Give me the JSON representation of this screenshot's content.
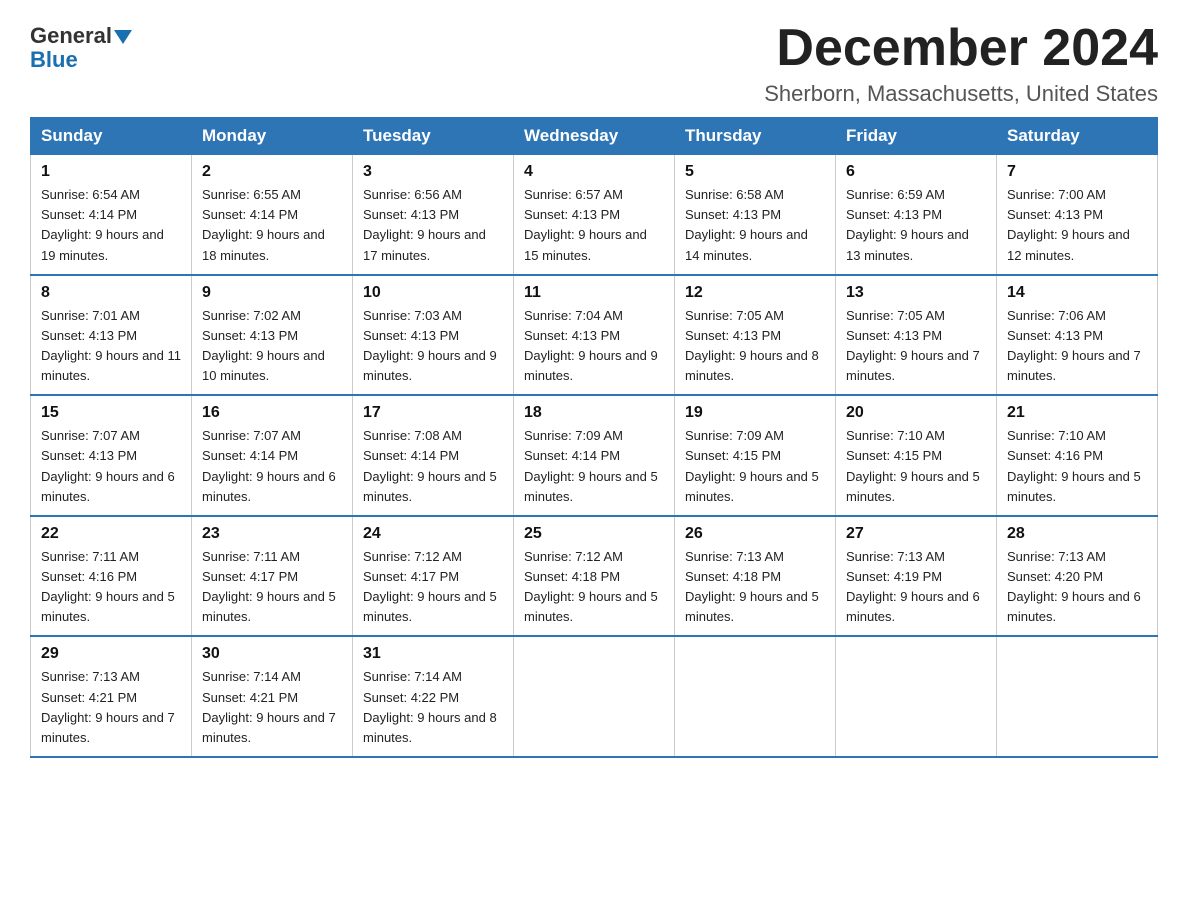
{
  "header": {
    "logo_line1": "General",
    "logo_line2": "Blue",
    "month_title": "December 2024",
    "location": "Sherborn, Massachusetts, United States"
  },
  "days_of_week": [
    "Sunday",
    "Monday",
    "Tuesday",
    "Wednesday",
    "Thursday",
    "Friday",
    "Saturday"
  ],
  "weeks": [
    [
      {
        "day": "1",
        "sunrise": "6:54 AM",
        "sunset": "4:14 PM",
        "daylight": "9 hours and 19 minutes."
      },
      {
        "day": "2",
        "sunrise": "6:55 AM",
        "sunset": "4:14 PM",
        "daylight": "9 hours and 18 minutes."
      },
      {
        "day": "3",
        "sunrise": "6:56 AM",
        "sunset": "4:13 PM",
        "daylight": "9 hours and 17 minutes."
      },
      {
        "day": "4",
        "sunrise": "6:57 AM",
        "sunset": "4:13 PM",
        "daylight": "9 hours and 15 minutes."
      },
      {
        "day": "5",
        "sunrise": "6:58 AM",
        "sunset": "4:13 PM",
        "daylight": "9 hours and 14 minutes."
      },
      {
        "day": "6",
        "sunrise": "6:59 AM",
        "sunset": "4:13 PM",
        "daylight": "9 hours and 13 minutes."
      },
      {
        "day": "7",
        "sunrise": "7:00 AM",
        "sunset": "4:13 PM",
        "daylight": "9 hours and 12 minutes."
      }
    ],
    [
      {
        "day": "8",
        "sunrise": "7:01 AM",
        "sunset": "4:13 PM",
        "daylight": "9 hours and 11 minutes."
      },
      {
        "day": "9",
        "sunrise": "7:02 AM",
        "sunset": "4:13 PM",
        "daylight": "9 hours and 10 minutes."
      },
      {
        "day": "10",
        "sunrise": "7:03 AM",
        "sunset": "4:13 PM",
        "daylight": "9 hours and 9 minutes."
      },
      {
        "day": "11",
        "sunrise": "7:04 AM",
        "sunset": "4:13 PM",
        "daylight": "9 hours and 9 minutes."
      },
      {
        "day": "12",
        "sunrise": "7:05 AM",
        "sunset": "4:13 PM",
        "daylight": "9 hours and 8 minutes."
      },
      {
        "day": "13",
        "sunrise": "7:05 AM",
        "sunset": "4:13 PM",
        "daylight": "9 hours and 7 minutes."
      },
      {
        "day": "14",
        "sunrise": "7:06 AM",
        "sunset": "4:13 PM",
        "daylight": "9 hours and 7 minutes."
      }
    ],
    [
      {
        "day": "15",
        "sunrise": "7:07 AM",
        "sunset": "4:13 PM",
        "daylight": "9 hours and 6 minutes."
      },
      {
        "day": "16",
        "sunrise": "7:07 AM",
        "sunset": "4:14 PM",
        "daylight": "9 hours and 6 minutes."
      },
      {
        "day": "17",
        "sunrise": "7:08 AM",
        "sunset": "4:14 PM",
        "daylight": "9 hours and 5 minutes."
      },
      {
        "day": "18",
        "sunrise": "7:09 AM",
        "sunset": "4:14 PM",
        "daylight": "9 hours and 5 minutes."
      },
      {
        "day": "19",
        "sunrise": "7:09 AM",
        "sunset": "4:15 PM",
        "daylight": "9 hours and 5 minutes."
      },
      {
        "day": "20",
        "sunrise": "7:10 AM",
        "sunset": "4:15 PM",
        "daylight": "9 hours and 5 minutes."
      },
      {
        "day": "21",
        "sunrise": "7:10 AM",
        "sunset": "4:16 PM",
        "daylight": "9 hours and 5 minutes."
      }
    ],
    [
      {
        "day": "22",
        "sunrise": "7:11 AM",
        "sunset": "4:16 PM",
        "daylight": "9 hours and 5 minutes."
      },
      {
        "day": "23",
        "sunrise": "7:11 AM",
        "sunset": "4:17 PM",
        "daylight": "9 hours and 5 minutes."
      },
      {
        "day": "24",
        "sunrise": "7:12 AM",
        "sunset": "4:17 PM",
        "daylight": "9 hours and 5 minutes."
      },
      {
        "day": "25",
        "sunrise": "7:12 AM",
        "sunset": "4:18 PM",
        "daylight": "9 hours and 5 minutes."
      },
      {
        "day": "26",
        "sunrise": "7:13 AM",
        "sunset": "4:18 PM",
        "daylight": "9 hours and 5 minutes."
      },
      {
        "day": "27",
        "sunrise": "7:13 AM",
        "sunset": "4:19 PM",
        "daylight": "9 hours and 6 minutes."
      },
      {
        "day": "28",
        "sunrise": "7:13 AM",
        "sunset": "4:20 PM",
        "daylight": "9 hours and 6 minutes."
      }
    ],
    [
      {
        "day": "29",
        "sunrise": "7:13 AM",
        "sunset": "4:21 PM",
        "daylight": "9 hours and 7 minutes."
      },
      {
        "day": "30",
        "sunrise": "7:14 AM",
        "sunset": "4:21 PM",
        "daylight": "9 hours and 7 minutes."
      },
      {
        "day": "31",
        "sunrise": "7:14 AM",
        "sunset": "4:22 PM",
        "daylight": "9 hours and 8 minutes."
      },
      null,
      null,
      null,
      null
    ]
  ]
}
